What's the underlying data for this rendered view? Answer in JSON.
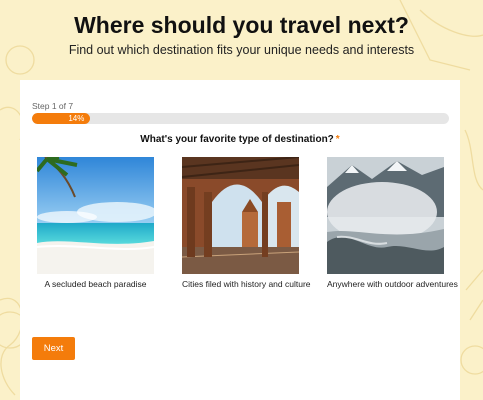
{
  "header": {
    "title": "Where should you travel next?",
    "subtitle": "Find out which destination fits your unique needs and interests"
  },
  "quiz": {
    "step_label": "Step 1 of 7",
    "progress_percent": 14,
    "progress_label": "14%",
    "question": "What's your favorite type of destination?",
    "required_mark": "*",
    "options": [
      {
        "caption": "A secluded beach paradise",
        "image": "tropical-beach-photo"
      },
      {
        "caption": "Cities filed with history and culture",
        "image": "historic-arcade-plaza-photo"
      },
      {
        "caption": "Anywhere with outdoor adventures",
        "image": "misty-mountain-lake-photo"
      }
    ],
    "next_label": "Next"
  },
  "colors": {
    "accent": "#f47c0b",
    "page_background": "#fbf1c9",
    "card_background": "#ffffff",
    "track": "#e6e6e6"
  }
}
